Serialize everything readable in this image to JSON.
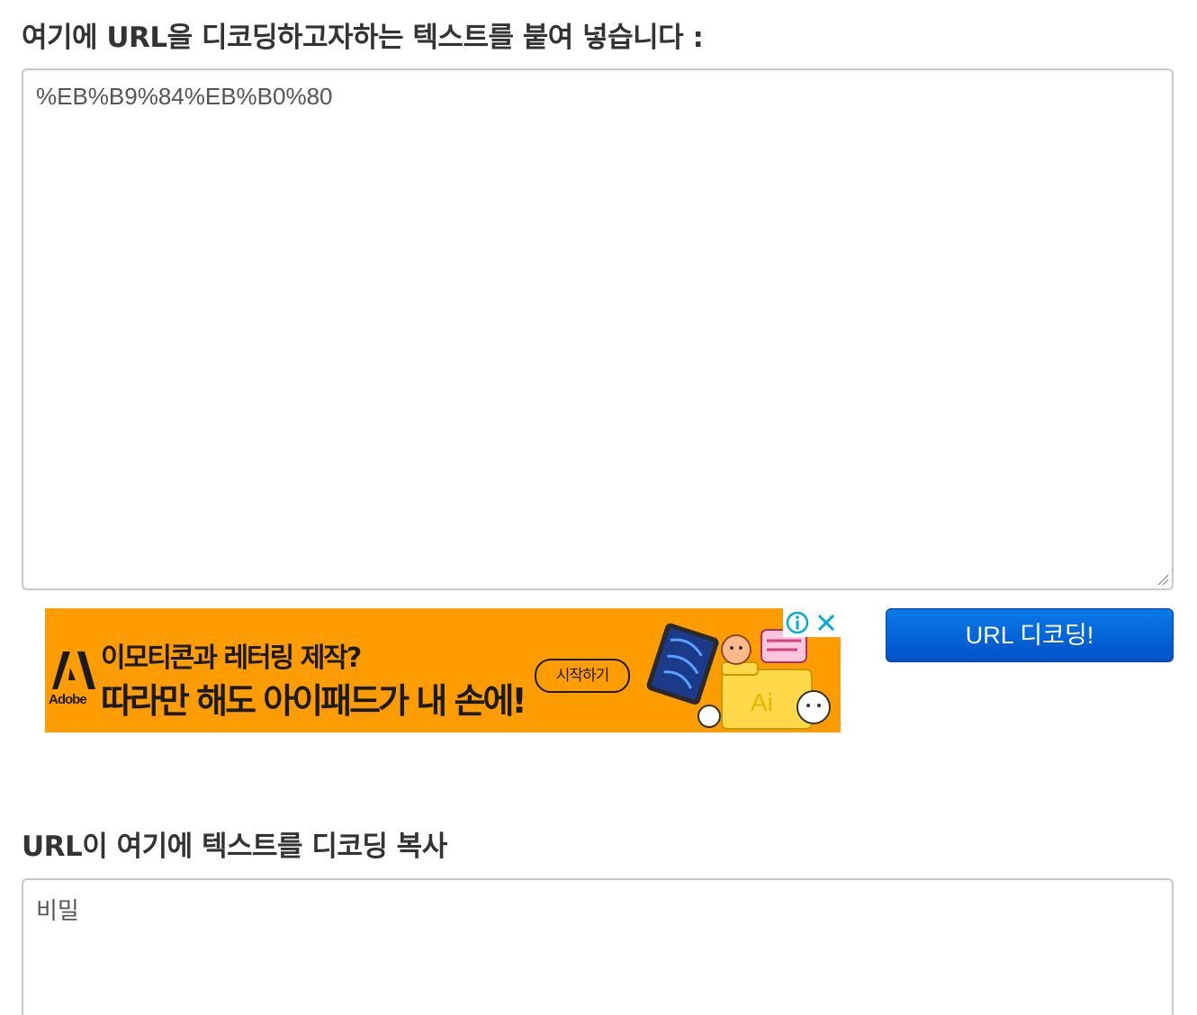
{
  "input_section": {
    "heading": "여기에 URL을 디코딩하고자하는 텍스트를 붙여 넣습니다 :",
    "value": "%EB%B9%84%EB%B0%80"
  },
  "decode_button": {
    "label": "URL 디코딩!"
  },
  "advertisement": {
    "brand": "Adobe",
    "line1": "이모티콘과 레터링 제작?",
    "line2": "따라만 해도 아이패드가 내 손에!",
    "cta": "시작하기",
    "art_text": "Ai",
    "brand_color": "#ff9d00",
    "info_icon": "info-icon",
    "close_icon": "close-icon"
  },
  "output_section": {
    "heading": "URL이 여기에 텍스트를 디코딩 복사",
    "value": "비밀"
  },
  "colors": {
    "button": "#0a6fe0",
    "text": "#333333",
    "border": "#c9c9c9"
  }
}
